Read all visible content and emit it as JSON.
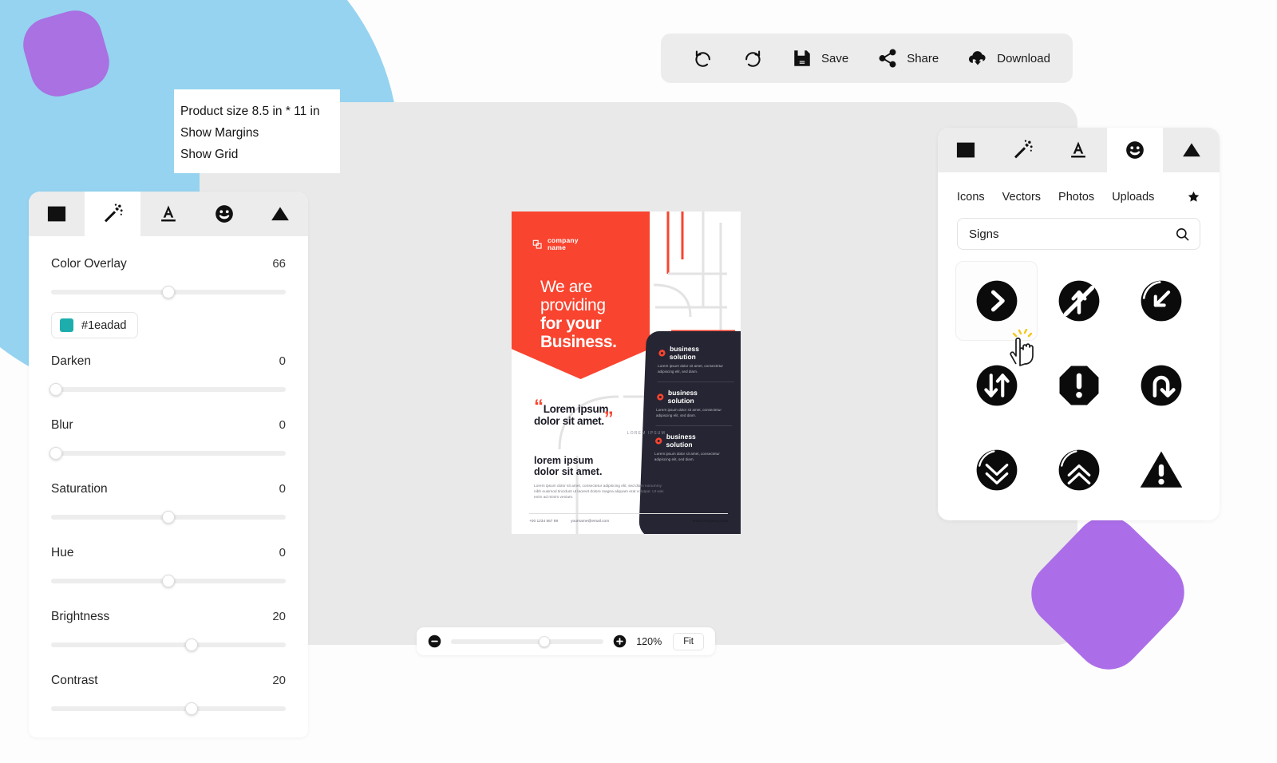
{
  "toolbar": {
    "items": [
      {
        "name": "undo",
        "icon": "undo-icon",
        "label": ""
      },
      {
        "name": "redo",
        "icon": "redo-icon",
        "label": ""
      },
      {
        "name": "save",
        "icon": "save-icon",
        "label": "Save"
      },
      {
        "name": "share",
        "icon": "share-icon",
        "label": "Share"
      },
      {
        "name": "download",
        "icon": "download-icon",
        "label": "Download"
      }
    ]
  },
  "tooltip": {
    "product_size": "Product size  8.5 in * 11 in",
    "show_margins": "Show Margins",
    "show_grid": "Show Grid"
  },
  "left_panel": {
    "tabs": [
      {
        "icon": "image-icon",
        "active": false
      },
      {
        "icon": "magic-wand-icon",
        "active": true
      },
      {
        "icon": "text-icon",
        "active": false
      },
      {
        "icon": "smiley-icon",
        "active": false
      },
      {
        "icon": "triangle-icon",
        "active": false
      }
    ],
    "color_swatch": {
      "hex": "#1eadad",
      "color": "#1eadad"
    },
    "controls": [
      {
        "label": "Color Overlay",
        "value": "66",
        "knob_pct": 50
      },
      {
        "label": "Darken",
        "value": "0",
        "knob_pct": 2
      },
      {
        "label": "Blur",
        "value": "0",
        "knob_pct": 2
      },
      {
        "label": "Saturation",
        "value": "0",
        "knob_pct": 50
      },
      {
        "label": "Hue",
        "value": "0",
        "knob_pct": 50
      },
      {
        "label": "Brightness",
        "value": "20",
        "knob_pct": 60
      },
      {
        "label": "Contrast",
        "value": "20",
        "knob_pct": 60
      }
    ]
  },
  "right_panel": {
    "tabs": [
      {
        "icon": "image-icon",
        "active": false
      },
      {
        "icon": "magic-wand-icon",
        "active": false
      },
      {
        "icon": "text-icon",
        "active": false
      },
      {
        "icon": "smiley-icon",
        "active": true
      },
      {
        "icon": "triangle-icon",
        "active": false
      }
    ],
    "categories": [
      "Icons",
      "Vectors",
      "Photos",
      "Uploads"
    ],
    "favorites_icon": "star-icon",
    "search": {
      "value": "Signs",
      "placeholder": "Search",
      "icon": "search-icon"
    },
    "results": [
      {
        "name": "arrow-right-circle-icon",
        "selected": true
      },
      {
        "name": "no-straight-ahead-icon",
        "selected": false
      },
      {
        "name": "arrow-down-left-circle-icon",
        "selected": false
      },
      {
        "name": "two-way-arrows-circle-icon",
        "selected": false
      },
      {
        "name": "exclamation-octagon-icon",
        "selected": false
      },
      {
        "name": "u-turn-circle-icon",
        "selected": false
      },
      {
        "name": "chevron-double-down-circle-icon",
        "selected": false
      },
      {
        "name": "chevron-double-up-circle-icon",
        "selected": false
      },
      {
        "name": "warning-triangle-icon",
        "selected": false
      }
    ]
  },
  "zoombar": {
    "minus_icon": "minus-circle-icon",
    "plus_icon": "plus-circle-icon",
    "percent": "120%",
    "knob_pct": 61,
    "fit_label": "Fit"
  },
  "poster": {
    "logo": {
      "line1": "company",
      "line2": "name"
    },
    "headline": {
      "l1": "We are",
      "l2": "providing",
      "l3": "for your",
      "l4": "Business."
    },
    "solutions": [
      {
        "title_l1": "business",
        "title_l2": "solution",
        "body": "Lorem ipsum dolor sit amet, consectetur adipiscing elit, sed diam."
      },
      {
        "title_l1": "business",
        "title_l2": "solution",
        "body": "Lorem ipsum dolor sit amet, consectetur adipiscing elit, sed diam."
      },
      {
        "title_l1": "business",
        "title_l2": "solution",
        "body": "Lorem ipsum dolor sit amet, consectetur adipiscing elit, sed diam."
      }
    ],
    "quote": {
      "l1": "Lorem ipsum",
      "l2": "dolor sit amet.",
      "sub": "LOREM IPSUM"
    },
    "subsection": {
      "title_l1": "lorem ipsum",
      "title_l2": "dolor sit amet.",
      "body": "Lorem ipsum dolor sit amet, consectetur adipiscing elit, sed diam nonummy nibh euismod tincidunt ut laoreet dolore magna aliquam erat volutpat. Ut wisi enim ad minim veniam."
    },
    "footer": {
      "phone": "+00 1234 567 89",
      "email": "yourname@email.com",
      "website": "www.company.com"
    },
    "colors": {
      "red": "#f9442f",
      "dark": "#262533"
    }
  },
  "theme": {
    "page_bg": "#fdfdfd",
    "canvas_bg": "#e9e9e9",
    "toolbar_bg": "#ececec",
    "deco_blue": "#95d3f0",
    "deco_purple": "#ac6ee8"
  }
}
